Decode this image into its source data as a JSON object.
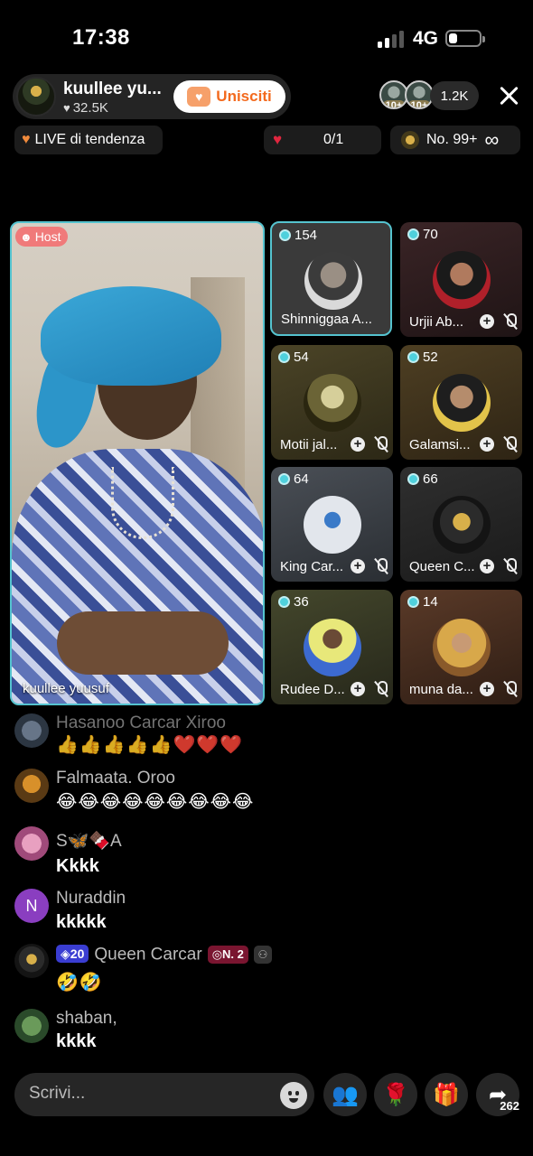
{
  "status_bar": {
    "time": "17:38",
    "network": "4G"
  },
  "host": {
    "name": "kuullee yu...",
    "likes": "32.5K",
    "join_label": "Unisciti",
    "video_name": "kuullee yuusuf",
    "role_badge": "Host"
  },
  "viewers": {
    "badges": [
      "10+",
      "10+"
    ],
    "count": "1.2K"
  },
  "chips": {
    "trending": "LIVE di tendenza",
    "goal": "0/1",
    "rank": "No. 99+"
  },
  "guests": [
    {
      "score": "154",
      "name": "Shinniggaa A..."
    },
    {
      "score": "70",
      "name": "Urjii Ab..."
    },
    {
      "score": "54",
      "name": "Motii jal..."
    },
    {
      "score": "52",
      "name": "Galamsi..."
    },
    {
      "score": "64",
      "name": "King Car..."
    },
    {
      "score": "66",
      "name": "Queen C..."
    },
    {
      "score": "36",
      "name": "Rudee D..."
    },
    {
      "score": "14",
      "name": "muna da..."
    }
  ],
  "chat": [
    {
      "user": "Hasanoo Carcar Xiroo",
      "message": "👍👍👍👍👍❤️❤️❤️"
    },
    {
      "user": "Falmaata. Oroo",
      "message": "😂😂😂😂😂😂😂😂😂"
    },
    {
      "user": "S🦋🍫A",
      "message": "Kkkk"
    },
    {
      "user": "Nuraddin",
      "avatar_letter": "N",
      "message": "kkkkk"
    },
    {
      "user": "Queen Carcar",
      "level": "20",
      "rank": "N. 2",
      "message": "🤣🤣"
    },
    {
      "user": "shaban,",
      "message": "kkkk"
    }
  ],
  "bottom_bar": {
    "comment_placeholder": "Scrivi...",
    "share_count": "262"
  },
  "colors": {
    "accent_cyan": "#55c3cf",
    "join_orange": "#f36a1e",
    "host_badge": "#f07a7a"
  }
}
